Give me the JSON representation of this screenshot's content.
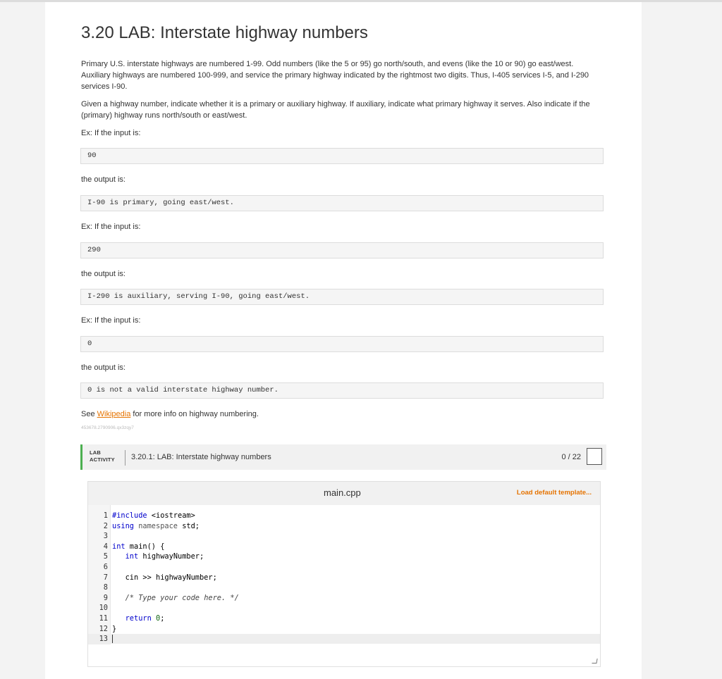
{
  "title": "3.20 LAB: Interstate highway numbers",
  "paragraphs": {
    "p1": "Primary U.S. interstate highways are numbered 1-99. Odd numbers (like the 5 or 95) go north/south, and evens (like the 10 or 90) go east/west. Auxiliary highways are numbered 100-999, and service the primary highway indicated by the rightmost two digits. Thus, I-405 services I-5, and I-290 services I-90.",
    "p2": "Given a highway number, indicate whether it is a primary or auxiliary highway. If auxiliary, indicate what primary highway it serves. Also indicate if the (primary) highway runs north/south or east/west."
  },
  "labels": {
    "ex_input": "Ex: If the input is:",
    "output_is": "the output is:"
  },
  "examples": [
    {
      "input": "90",
      "output": "I-90 is primary, going east/west."
    },
    {
      "input": "290",
      "output": "I-290 is auxiliary, serving I-90, going east/west."
    },
    {
      "input": "0",
      "output": "0 is not a valid interstate highway number."
    }
  ],
  "see_more": {
    "prefix": "See ",
    "link": "Wikipedia",
    "suffix": " for more info on highway numbering."
  },
  "tiny_id": "453678.2790906.qx3zqy7",
  "lab": {
    "word1": "LAB",
    "word2": "ACTIVITY",
    "title": "3.20.1: LAB: Interstate highway numbers",
    "score": "0 / 22"
  },
  "editor": {
    "filename": "main.cpp",
    "load_template": "Load default template..."
  },
  "code_lines": [
    "1",
    "2",
    "3",
    "4",
    "5",
    "6",
    "7",
    "8",
    "9",
    "10",
    "11",
    "12",
    "13"
  ]
}
